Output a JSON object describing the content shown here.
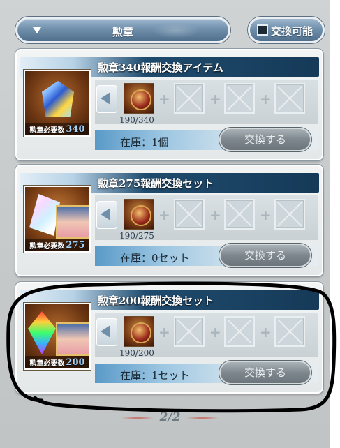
{
  "header": {
    "filter_label": "勲章",
    "toggle_label": "交換可能"
  },
  "cards": [
    {
      "title": "勲章340報酬交換アイテム",
      "required_label": "勲章必要数",
      "required_value": "340",
      "count": "190/340",
      "stock": "在庫：1個",
      "button": "交換する"
    },
    {
      "title": "勲章275報酬交換セット",
      "required_label": "勲章必要数",
      "required_value": "275",
      "count": "190/275",
      "stock": "在庫：0セット",
      "button": "交換する"
    },
    {
      "title": "勲章200報酬交換セット",
      "required_label": "勲章必要数",
      "required_value": "200",
      "count": "190/200",
      "stock": "在庫：1セット",
      "button": "交換する"
    }
  ],
  "pager": {
    "label": "2/2"
  },
  "colors": {
    "accent_blue": "#1f4b6e",
    "button_gray": "#7d878d",
    "annotation": "#000000"
  }
}
